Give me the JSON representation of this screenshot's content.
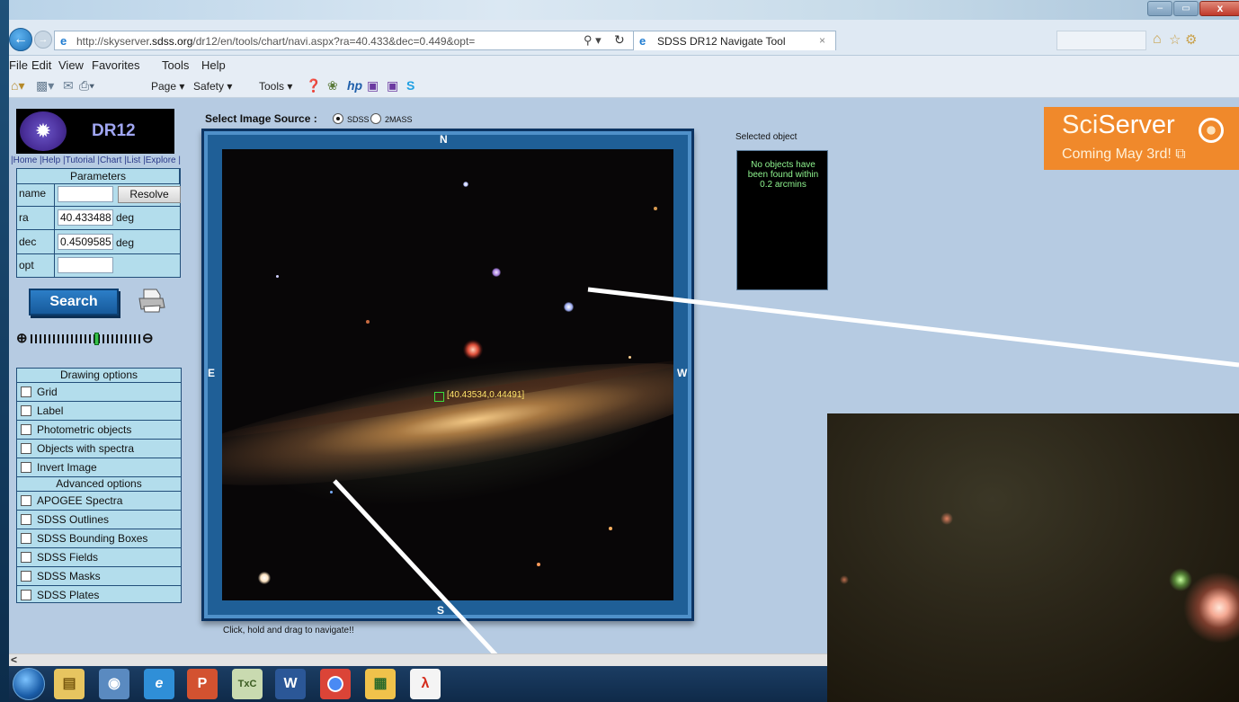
{
  "browser": {
    "url_prefix": "http://skyserver",
    "url_domain": ".sdss.org",
    "url_rest": "/dr12/en/tools/chart/navi.aspx?ra=40.433&dec=0.449&opt=",
    "tab_title": "SDSS DR12 Navigate Tool",
    "tab_close": "×",
    "menu": [
      "File",
      "Edit",
      "View",
      "Favorites",
      "Tools",
      "Help"
    ],
    "commands": [
      "Page ▾",
      "Safety ▾",
      "Tools ▾"
    ],
    "window_controls": [
      "–",
      "▭",
      "x"
    ]
  },
  "sidebar": {
    "logo_text": "DR12",
    "nav_links": "|Home |Help |Tutorial |Chart |List |Explore |",
    "params_header": "Parameters",
    "params": [
      {
        "label": "name",
        "value": ""
      },
      {
        "label": "ra",
        "value": "40.433488",
        "unit": "deg"
      },
      {
        "label": "dec",
        "value": "0.4509585",
        "unit": "deg"
      },
      {
        "label": "opt",
        "value": ""
      }
    ],
    "resolve_label": "Resolve",
    "search_label": "Search",
    "zoom_level": 0.6,
    "drawing_header": "Drawing options",
    "drawing_options": [
      "Grid",
      "Label",
      "Photometric objects",
      "Objects with spectra",
      "Invert Image"
    ],
    "advanced_header": "Advanced options",
    "advanced_options": [
      "APOGEE Spectra",
      "SDSS Outlines",
      "SDSS Bounding Boxes",
      "SDSS Fields",
      "SDSS Masks",
      "SDSS Plates"
    ]
  },
  "viewer": {
    "source_label": "Select Image Source :",
    "sources": [
      "SDSS",
      "2MASS"
    ],
    "selected_source": "SDSS",
    "directions": {
      "north": "N",
      "south": "S",
      "east": "E",
      "west": "W"
    },
    "coordinate_label": "[40.43534,0.44491]",
    "drag_hint": "Click, hold and drag to navigate!!"
  },
  "selected_object": {
    "title": "Selected object",
    "message": "No objects have been found within 0.2 arcmins"
  },
  "sciserver": {
    "title_a": "Sci",
    "title_b": "Server",
    "subtitle": "Coming May 3rd! ⧉"
  },
  "colors": {
    "slide_bg": "#133b5f",
    "page_bg": "#b6cbe2",
    "table_bg": "#b3ddec",
    "frame_blue": "#1f5f97",
    "sciserver_orange": "#f0892b",
    "coord_yellow": "#ffe56b"
  }
}
